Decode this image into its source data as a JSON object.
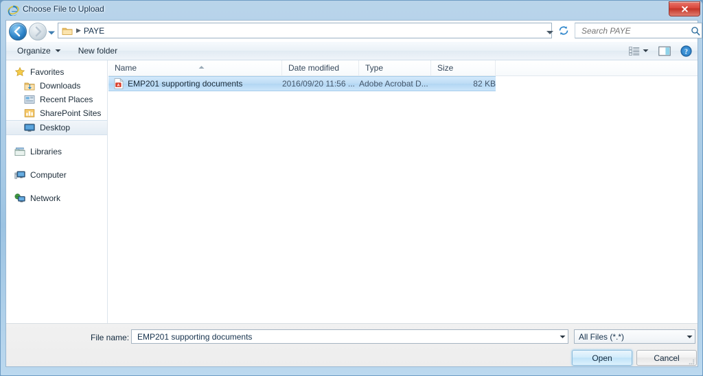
{
  "window": {
    "title": "Choose File to Upload",
    "title_icon": "internet-explorer-icon",
    "close_label": "Close"
  },
  "navbar": {
    "back_label": "Back",
    "forward_label": "Forward",
    "history_label": "Recent pages",
    "breadcrumb": "PAYE",
    "address_dropdown_label": "Previous locations",
    "refresh_label": "Refresh",
    "search": {
      "placeholder": "Search PAYE",
      "value": ""
    }
  },
  "command_bar": {
    "organize_label": "Organize",
    "new_folder_label": "New folder",
    "views_label": "Change your view",
    "preview_label": "Show the preview pane",
    "help_label": "Get help"
  },
  "sidebar": {
    "groups": [
      {
        "header": {
          "label": "Favorites",
          "icon": "star-icon"
        },
        "items": [
          {
            "label": "Downloads",
            "icon": "downloads-folder-icon",
            "selected": false
          },
          {
            "label": "Recent Places",
            "icon": "recent-places-icon",
            "selected": false
          },
          {
            "label": "SharePoint Sites",
            "icon": "sharepoint-sites-icon",
            "selected": false
          },
          {
            "label": "Desktop",
            "icon": "desktop-icon",
            "selected": true
          }
        ]
      },
      {
        "header": {
          "label": "Libraries",
          "icon": "libraries-icon"
        },
        "items": []
      },
      {
        "header": {
          "label": "Computer",
          "icon": "computer-icon"
        },
        "items": []
      },
      {
        "header": {
          "label": "Network",
          "icon": "network-icon"
        },
        "items": []
      }
    ]
  },
  "file_list": {
    "columns": [
      {
        "label": "Name",
        "sorted": "ascending"
      },
      {
        "label": "Date modified",
        "sorted": ""
      },
      {
        "label": "Type",
        "sorted": ""
      },
      {
        "label": "Size",
        "sorted": ""
      }
    ],
    "rows": [
      {
        "icon": "pdf-file-icon",
        "name": "EMP201 supporting documents",
        "date_modified": "2016/09/20 11:56 ...",
        "type": "Adobe Acrobat D...",
        "size": "82 KB",
        "selected": true
      }
    ]
  },
  "footer": {
    "file_name_label": "File name:",
    "file_name_value": "EMP201 supporting documents",
    "file_type_value": "All Files (*.*)",
    "open_label": "Open",
    "cancel_label": "Cancel"
  },
  "colors": {
    "frame": "#a9cbe6",
    "selection": "#bddcf5",
    "accent": "#2f86cb",
    "close_red": "#d9483c"
  }
}
